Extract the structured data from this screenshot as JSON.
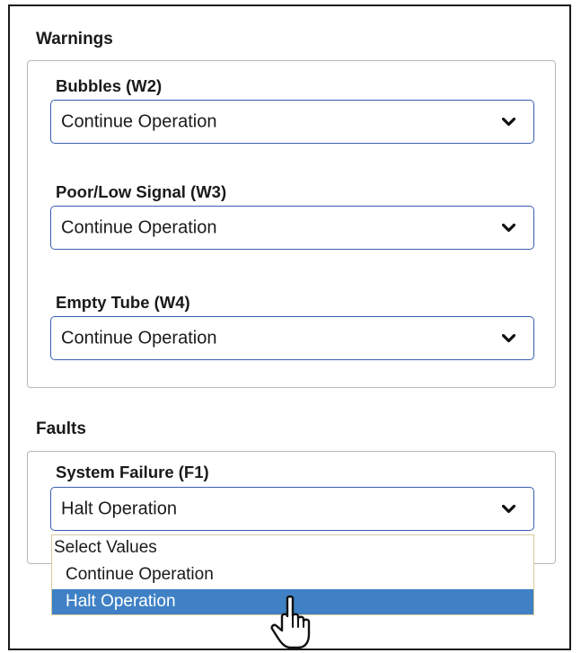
{
  "warnings": {
    "heading": "Warnings",
    "fields": [
      {
        "label": "Bubbles (W2)",
        "value": "Continue Operation",
        "chevron_icon": "chevron-down-icon"
      },
      {
        "label": "Poor/Low Signal (W3)",
        "value": "Continue Operation",
        "chevron_icon": "chevron-down-icon"
      },
      {
        "label": "Empty Tube (W4)",
        "value": "Continue Operation",
        "chevron_icon": "chevron-down-icon"
      }
    ]
  },
  "faults": {
    "heading": "Faults",
    "fields": [
      {
        "label": "System Failure (F1)",
        "value": "Halt Operation",
        "chevron_icon": "chevron-down-icon"
      }
    ],
    "dropdown": {
      "open": true,
      "options": [
        "Select Values",
        "Continue Operation",
        "Halt Operation"
      ],
      "highlighted": "Halt Operation"
    }
  },
  "colors": {
    "select_border": "#3a5db0",
    "highlight_bg": "#3f81c4",
    "fieldset_border": "#b9b9b9"
  },
  "cursor": {
    "icon": "hand-pointer-icon"
  }
}
